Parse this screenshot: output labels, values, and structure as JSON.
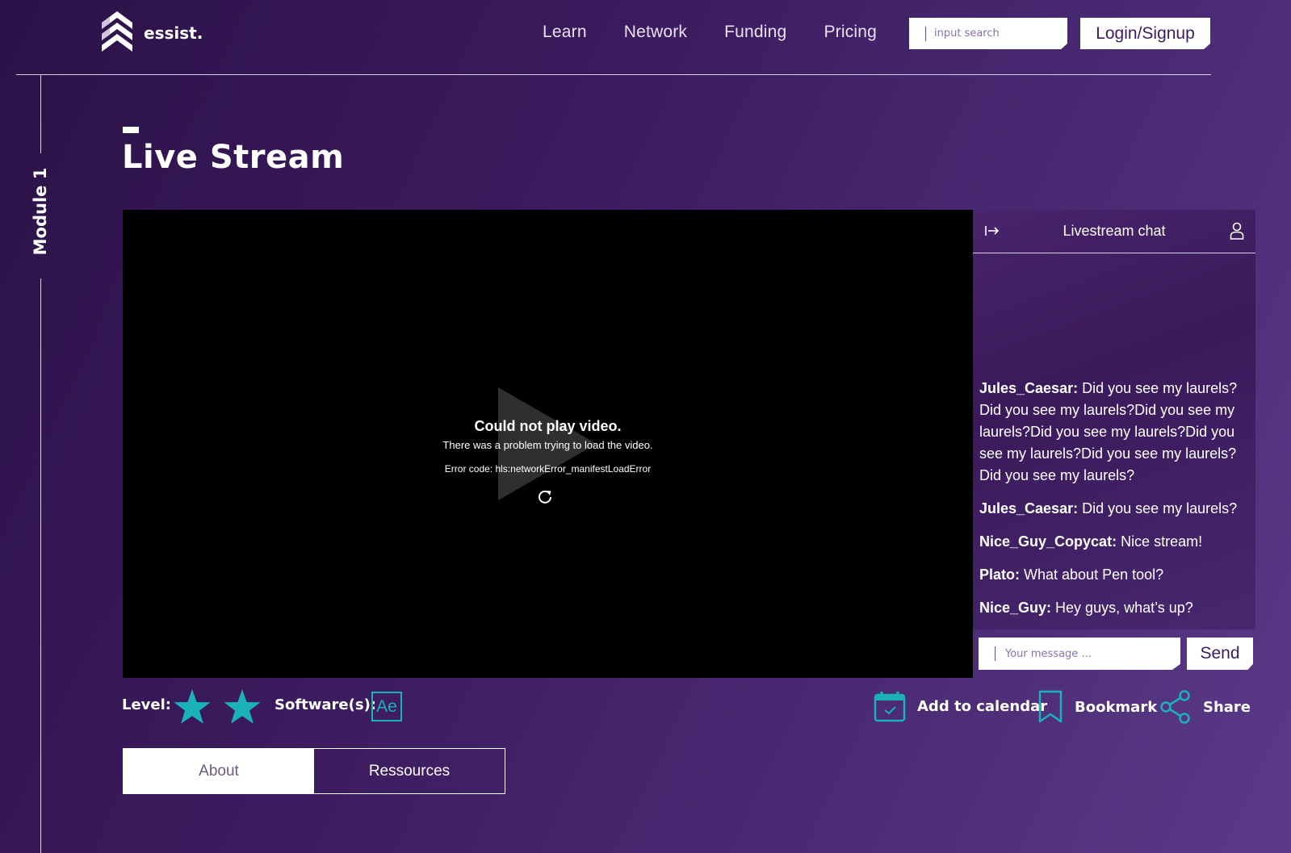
{
  "header": {
    "logo_text": "essist.",
    "nav": [
      "Learn",
      "Network",
      "Funding",
      "Pricing"
    ],
    "search_placeholder": "input search",
    "login_label": "Login/Signup"
  },
  "sidebar": {
    "module_label": "Module 1"
  },
  "page": {
    "title": "Live Stream"
  },
  "video": {
    "error_title": "Could not play video.",
    "error_message": "There was a problem trying to load the video.",
    "error_code": "Error code: hls:networkError_manifestLoadError"
  },
  "chat": {
    "title": "Livestream chat",
    "messages": [
      {
        "user": "Jules_Caesar:",
        "text": " Did you see my laurels? Did you see my laurels?Did you see my laurels?Did you see my laurels?Did you see my laurels?Did you see my laurels? Did you see my laurels?"
      },
      {
        "user": "Jules_Caesar:",
        "text": " Did you see my laurels?"
      },
      {
        "user": "Nice_Guy_Copycat:",
        "text": " Nice stream!"
      },
      {
        "user": "Plato:",
        "text": " What about Pen tool?"
      },
      {
        "user": "Nice_Guy:",
        "text": " Hey guys, what’s up?"
      }
    ],
    "input_placeholder": "Your message ...",
    "send_label": "Send"
  },
  "meta": {
    "level_label": "Level:",
    "level_stars": 2,
    "software_label": "Software(s):",
    "software_badge": "Ae",
    "accent_color": "#1ab2b8"
  },
  "actions": {
    "calendar_label": "Add to calendar",
    "bookmark_label": "Bookmark",
    "share_label": "Share"
  },
  "tabs": [
    "About",
    "Ressources"
  ]
}
